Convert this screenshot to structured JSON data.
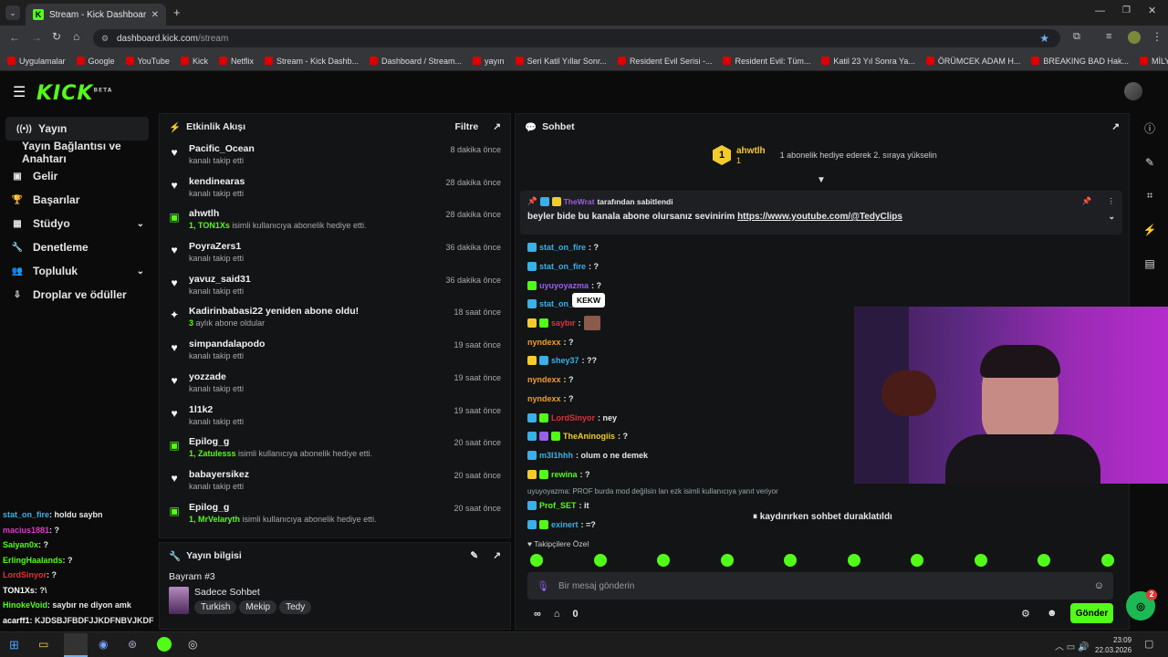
{
  "browser": {
    "tab_title": "Stream - Kick Dashboard",
    "url_host": "dashboard.kick.com",
    "url_path": "/stream",
    "bookmarks": [
      "Uygulamalar",
      "Google",
      "YouTube",
      "Kick",
      "Netflix",
      "Stream - Kick Dashb...",
      "Dashboard / Stream...",
      "yayın",
      "Seri Katil Yıllar Sonr...",
      "Resident Evil Serisi -...",
      "Resident Evil: Tüm...",
      "Katil 23 Yıl Sonra Ya...",
      "ÖRÜMCEK ADAM H...",
      "BREAKING BAD Hak...",
      "MİLYONLAR ÇALAR..."
    ]
  },
  "brand": {
    "logo": "KICK",
    "beta": "BETA",
    "accent": "#53fc18"
  },
  "sidebar": {
    "items": [
      {
        "label": "Yayın",
        "icon": "broadcast-icon"
      },
      {
        "label": "Yayın Bağlantısı ve Anahtarı",
        "icon": ""
      },
      {
        "label": "Gelir",
        "icon": "wallet-icon"
      },
      {
        "label": "Başarılar",
        "icon": "trophy-icon"
      },
      {
        "label": "Stüdyo",
        "icon": "studio-icon"
      },
      {
        "label": "Denetleme",
        "icon": "wrench-icon"
      },
      {
        "label": "Topluluk",
        "icon": "people-icon"
      },
      {
        "label": "Droplar ve ödüller",
        "icon": "drops-icon"
      }
    ]
  },
  "left_chat": [
    {
      "user": "stat_on_fire",
      "text": ": holdu saybn",
      "color": "#3ab0e8"
    },
    {
      "user": "macius1881",
      "text": ": ?",
      "color": "#e03ac9"
    },
    {
      "user": "Saiyan0x",
      "text": ": ?",
      "color": "#53fc18"
    },
    {
      "user": "ErlingHaalands",
      "text": ": ?",
      "color": "#53fc18"
    },
    {
      "user": "LordSinyor",
      "text": ": ?",
      "color": "#e0303a"
    },
    {
      "user": "TON1Xs",
      "text": ": ?\\",
      "color": "#ffffff"
    },
    {
      "user": "HinokeVoid",
      "text": ": saybır ne diyon amk",
      "color": "#53fc18"
    },
    {
      "user": "acarff1",
      "text": ": KJDSBJFBDFJJKDFNBVJKDF",
      "color": "#ffffff"
    }
  ],
  "activity": {
    "title": "Etkinlik Akışı",
    "filter": "Filtre",
    "rows": [
      {
        "name": "Pacific_Ocean",
        "sub": "kanalı takip etti",
        "subnum": "",
        "time": "8 dakika önce",
        "icon": "heart-icon"
      },
      {
        "name": "kendinearas",
        "sub": "kanalı takip etti",
        "subnum": "",
        "time": "28 dakika önce",
        "icon": "heart-icon"
      },
      {
        "name": "ahwtlh",
        "sub": "isimli kullanıcıya abonelik hediye etti.",
        "subnum": "1, TON1Xs",
        "time": "28 dakika önce",
        "icon": "gift-icon"
      },
      {
        "name": "PoyraZers1",
        "sub": "kanalı takip etti",
        "subnum": "",
        "time": "36 dakika önce",
        "icon": "heart-icon"
      },
      {
        "name": "yavuz_said31",
        "sub": "kanalı takip etti",
        "subnum": "",
        "time": "36 dakika önce",
        "icon": "heart-icon"
      },
      {
        "name": "Kadirinbabasi22 yeniden abone oldu!",
        "sub": "aylık abone oldular",
        "subnum": "3",
        "time": "18 saat önce",
        "icon": "sparkle-icon"
      },
      {
        "name": "simpandalapodo",
        "sub": "kanalı takip etti",
        "subnum": "",
        "time": "19 saat önce",
        "icon": "heart-icon"
      },
      {
        "name": "yozzade",
        "sub": "kanalı takip etti",
        "subnum": "",
        "time": "19 saat önce",
        "icon": "heart-icon"
      },
      {
        "name": "1l1k2",
        "sub": "kanalı takip etti",
        "subnum": "",
        "time": "19 saat önce",
        "icon": "heart-icon"
      },
      {
        "name": "Epilog_g",
        "sub": "isimli kullanıcıya abonelik hediye etti.",
        "subnum": "1, Zatulesss",
        "time": "20 saat önce",
        "icon": "gift-icon"
      },
      {
        "name": "babayersikez",
        "sub": "kanalı takip etti",
        "subnum": "",
        "time": "20 saat önce",
        "icon": "heart-icon"
      },
      {
        "name": "Epilog_g",
        "sub": "isimli kullanıcıya abonelik hediye etti.",
        "subnum": "1, MrVelaryth",
        "time": "20 saat önce",
        "icon": "gift-icon"
      }
    ]
  },
  "stream_info": {
    "title": "Yayın bilgisi",
    "stream_title": "Bayram #3",
    "category": "Sadece Sohbet",
    "tags": [
      "Turkish",
      "Mekip",
      "Tedy"
    ]
  },
  "chat": {
    "title": "Sohbet",
    "leader": {
      "rank": "1",
      "name": "ahwtlh",
      "count": "1",
      "hint": "1 abonelik hediye ederek 2. sıraya yükselin"
    },
    "pinned": {
      "by": "TheWrat",
      "by_suffix": "tarafından sabitlendi",
      "text": "beyler bide bu kanala abone olursanız sevinirim",
      "link": "https://www.youtube.com/@TedyClips"
    },
    "tooltip": "KEKW",
    "messages": [
      {
        "user": "stat_on_fire",
        "text": ": ?",
        "color": "#3ab0e8",
        "badges": [
          "b-blue"
        ]
      },
      {
        "user": "stat_on_fire",
        "text": ": ?",
        "color": "#3ab0e8",
        "badges": [
          "b-blue"
        ]
      },
      {
        "user": "uyuyoyazma",
        "text": ": ?",
        "color": "#9a60e8",
        "badges": [
          "b-green"
        ]
      },
      {
        "user": "stat_on_f",
        "text": "",
        "color": "#3ab0e8",
        "badges": [
          "b-blue"
        ]
      },
      {
        "user": "saybır",
        "text": ":",
        "color": "#e0303a",
        "badges": [
          "b-yel",
          "b-green"
        ]
      },
      {
        "user": "nyndexx",
        "text": ": ?",
        "color": "#f39c2c",
        "badges": []
      },
      {
        "user": "shey37",
        "text": ": ??",
        "color": "#3ab0e8",
        "badges": [
          "b-yel",
          "b-blue"
        ]
      },
      {
        "user": "nyndexx",
        "text": ": ?",
        "color": "#f39c2c",
        "badges": []
      },
      {
        "user": "nyndexx",
        "text": ": ?",
        "color": "#f39c2c",
        "badges": []
      },
      {
        "user": "LordSinyor",
        "text": ": ney",
        "color": "#e0303a",
        "badges": [
          "b-blue",
          "b-green"
        ]
      },
      {
        "user": "TheAninogiis",
        "text": ": ?",
        "color": "#f3cc2c",
        "badges": [
          "b-blue",
          "b-pur",
          "b-green"
        ]
      },
      {
        "user": "m3l1hhh",
        "text": ": olum o ne demek",
        "color": "#3ab0e8",
        "badges": [
          "b-blue"
        ]
      },
      {
        "user": "rewina",
        "text": ": ?",
        "color": "#53fc18",
        "badges": [
          "b-yel",
          "b-green"
        ]
      }
    ],
    "reply_hint": "uyuyoyazma: PROF burda mod değilsin lan ezk isimli kullanıcıya yanıt veriyor",
    "after": [
      {
        "user": "Prof_SET",
        "text": ": it",
        "color": "#53fc18",
        "badges": [
          "b-blue"
        ]
      },
      {
        "user": "exinert",
        "text": ": =?",
        "color": "#3ab0e8",
        "badges": [
          "b-blue",
          "b-green"
        ]
      }
    ],
    "paused": "kaydırırken sohbet duraklatıldı",
    "emote_label": "Takipçilere Özel",
    "input_placeholder": "Bir mesaj gönderin",
    "send": "Gönder",
    "viewers": "0",
    "notif_count": "2"
  },
  "taskbar": {
    "time": "23:09",
    "date": "22.03.2026"
  }
}
